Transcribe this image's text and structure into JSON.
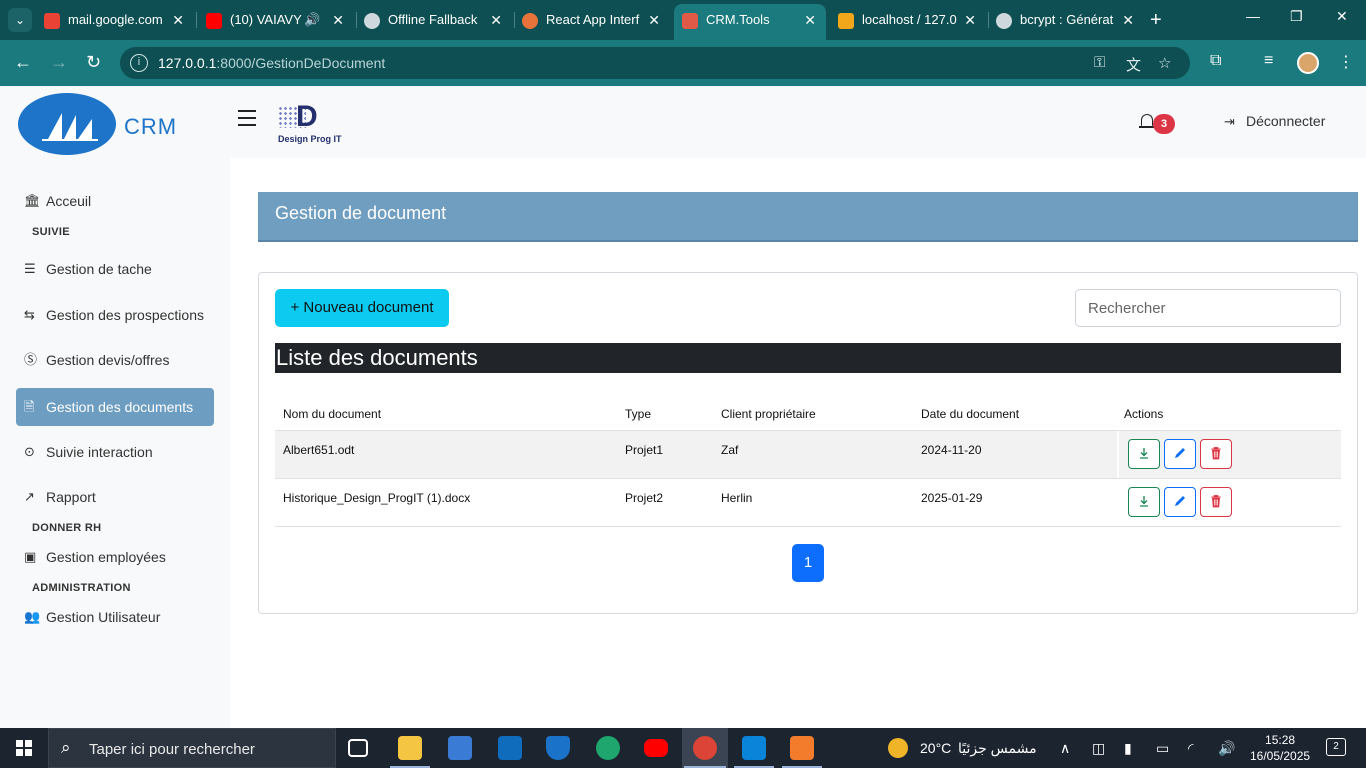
{
  "browser": {
    "tabs": [
      {
        "title": "mail.google.com",
        "favicon_color": "#ea4335",
        "favicon": "gmail-icon"
      },
      {
        "title": "(10) VAIAVY",
        "favicon_color": "#ff0000",
        "favicon": "youtube-icon"
      },
      {
        "title": "Offline Fallback",
        "favicon_color": "#cfd8dc",
        "favicon": "globe-icon"
      },
      {
        "title": "React App Interf",
        "favicon_color": "#e8733a",
        "favicon": "react-icon"
      },
      {
        "title": "CRM.Tools",
        "favicon_color": "#e05a47",
        "favicon": "laravel-icon"
      },
      {
        "title": "localhost / 127.0",
        "favicon_color": "#f2a71b",
        "favicon": "phpmyadmin-icon"
      },
      {
        "title": "bcrypt : Générat",
        "favicon_color": "#cfd8dc",
        "favicon": "globe-icon"
      }
    ],
    "url_host": "127.0.0.1",
    "url_path": ":8000/GestionDeDocument"
  },
  "header": {
    "app_name": "CRM",
    "partner_logo_text": "Design Prog IT",
    "notification_count": "3",
    "logout_label": "Déconnecter"
  },
  "sidebar": {
    "home": "Acceuil",
    "section_suivie": "SUIVIE",
    "items": [
      {
        "label": "Gestion de tache",
        "icon": "list-icon"
      },
      {
        "label": "Gestion des prospections",
        "icon": "arrows-icon"
      },
      {
        "label": "Gestion devis/offres",
        "icon": "dollar-icon"
      },
      {
        "label": "Gestion des documents",
        "icon": "document-icon"
      },
      {
        "label": "Suivie interaction",
        "icon": "target-icon"
      },
      {
        "label": "Rapport",
        "icon": "chart-icon"
      }
    ],
    "section_rh": "DONNER RH",
    "employees": "Gestion employées",
    "section_admin": "ADMINISTRATION",
    "users": "Gestion Utilisateur"
  },
  "main": {
    "page_title": "Gestion de document",
    "new_button": "+ Nouveau document",
    "search_placeholder": "Rechercher",
    "list_title": "Liste des documents",
    "columns": [
      "Nom du document",
      "Type",
      "Client propriétaire",
      "Date du document",
      "Actions"
    ],
    "rows": [
      {
        "name": "Albert651.odt",
        "type": "Projet1",
        "client": "Zaf",
        "date": "2024-11-20"
      },
      {
        "name": "Historique_Design_ProgIT (1).docx",
        "type": "Projet2",
        "client": "Herlin",
        "date": "2025-01-29"
      }
    ],
    "page": "1"
  },
  "taskbar": {
    "search_placeholder": "Taper ici pour rechercher",
    "weather_temp": "20°C",
    "weather_text": "مشمس جزئيًا",
    "time": "15:28",
    "date": "16/05/2025",
    "notifications": "2"
  },
  "colors": {
    "accent": "#0dcaf0",
    "primary": "#0d6efd",
    "page_header": "#6f9ec0",
    "sidebar_active": "#6d9ec2",
    "danger": "#dc3545",
    "success": "#198754"
  }
}
